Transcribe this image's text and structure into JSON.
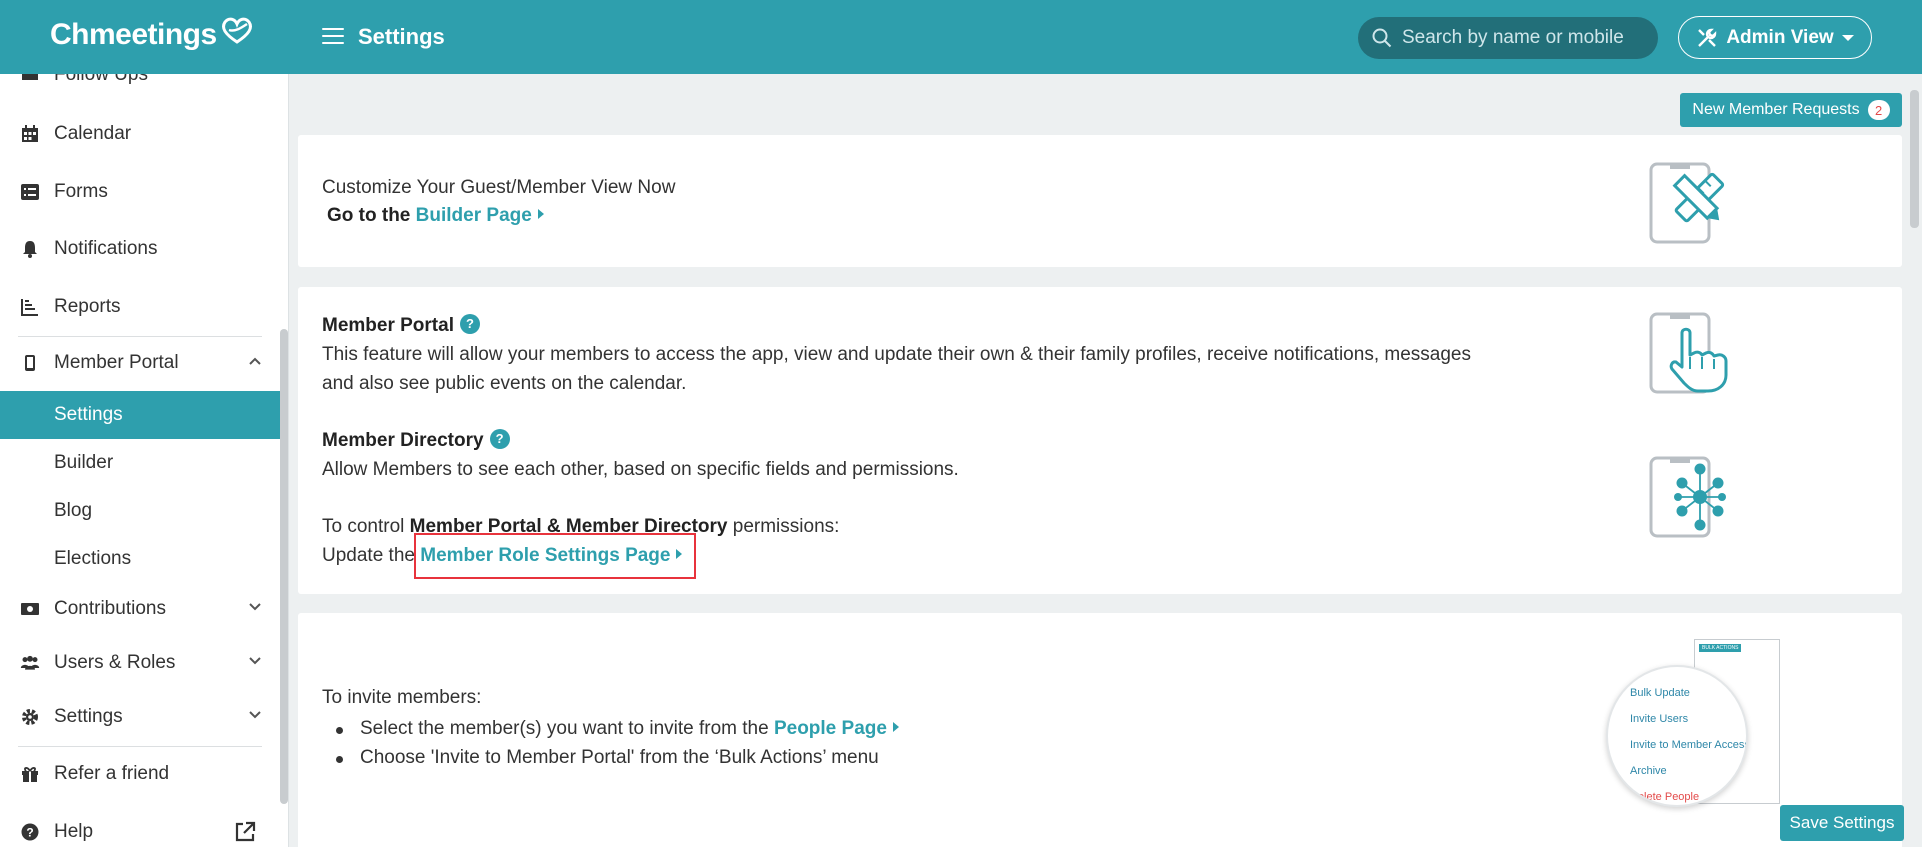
{
  "header": {
    "logo": "Chmeetings",
    "title": "Settings",
    "search_placeholder": "Search by name or mobile",
    "view_label": "Admin View"
  },
  "sidebar": {
    "items": [
      {
        "label": "Follow Ups",
        "icon": "follow-ups-icon"
      },
      {
        "label": "Calendar",
        "icon": "calendar-icon"
      },
      {
        "label": "Forms",
        "icon": "forms-icon"
      },
      {
        "label": "Notifications",
        "icon": "bell-icon"
      },
      {
        "label": "Reports",
        "icon": "reports-icon"
      },
      {
        "label": "Member Portal",
        "icon": "mobile-icon",
        "expanded": true
      },
      {
        "label": "Contributions",
        "icon": "money-icon"
      },
      {
        "label": "Users & Roles",
        "icon": "users-icon"
      },
      {
        "label": "Settings",
        "icon": "gear-icon"
      },
      {
        "label": "Refer a friend",
        "icon": "gift-icon"
      },
      {
        "label": "Help",
        "icon": "question-icon"
      }
    ],
    "member_portal_sub": [
      "Settings",
      "Builder",
      "Blog",
      "Elections"
    ],
    "active_sub": "Settings"
  },
  "new_requests": {
    "label": "New Member Requests",
    "count": "2"
  },
  "customize_card": {
    "line1": "Customize Your Guest/Member View Now",
    "line2_prefix": "Go to the",
    "link": "Builder Page"
  },
  "portal_card": {
    "portal_title": "Member Portal",
    "portal_desc_1": "This feature will allow your members to access the app, view and update their own & their family profiles, receive notifications, messages",
    "portal_desc_2": "and also see public events on the calendar.",
    "directory_title": "Member Directory",
    "directory_desc": "Allow Members to see each other, based on specific fields and permissions.",
    "control_prefix": "To control",
    "control_bold": "Member Portal & Member Directory",
    "control_suffix": "permissions:",
    "update_prefix": "Update the",
    "update_link": "Member Role Settings Page"
  },
  "invite_card": {
    "title": "To invite members:",
    "step1_prefix": "Select the member(s) you want to invite from the",
    "step1_link": "People Page",
    "step2": "Choose 'Invite to Member Portal' from the ‘Bulk Actions’ menu",
    "menu_items": [
      "Bulk Update",
      "Invite Users",
      "Invite to Member Access",
      "Archive",
      "Delete People"
    ],
    "mini_header": "BULK ACTIONS"
  },
  "footer": {
    "save_label": "Save Settings"
  },
  "colors": {
    "accent": "#2e9fad",
    "highlight": "#e8333c",
    "badge_text": "#e34a4a"
  }
}
